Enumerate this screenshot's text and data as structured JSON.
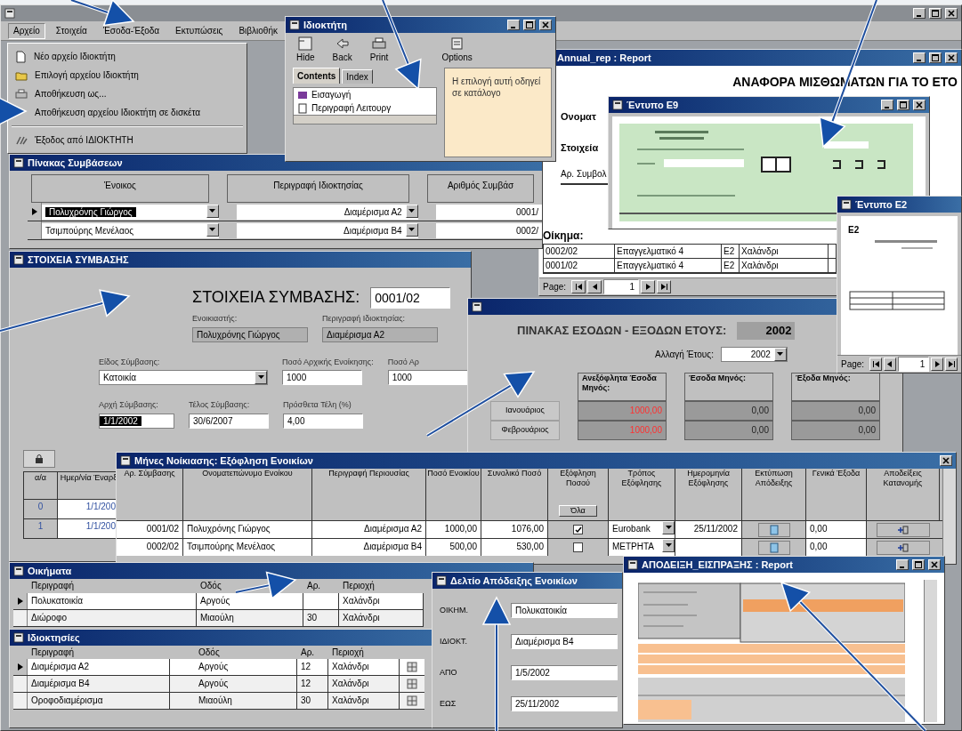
{
  "app": {
    "menu": [
      {
        "label": "Αρχείο",
        "selected": true
      },
      {
        "label": "Στοιχεία",
        "selected": false
      },
      {
        "label": "Έσοδα-Έξοδα",
        "selected": false
      },
      {
        "label": "Εκτυπώσεις",
        "selected": false
      },
      {
        "label": "Βιβλιοθήκ",
        "selected": false
      }
    ]
  },
  "file_menu": {
    "items": [
      {
        "label": "Νέο αρχείο Ιδιοκτήτη",
        "kind": "new"
      },
      {
        "label": "Επιλογή αρχείου Ιδιοκτήτη",
        "kind": "open"
      },
      {
        "label": "Αποθήκευση ως...",
        "kind": "save"
      },
      {
        "label": "Αποθήκευση αρχείου Ιδιοκτήτη σε δισκέτα",
        "kind": "plain"
      },
      {
        "kind": "separator"
      },
      {
        "label": "Έξοδος από ΙΔΙΟΚΤΗΤΗ",
        "kind": "exit"
      }
    ]
  },
  "help_window": {
    "title": "Ιδιοκτήτη",
    "toolbar": [
      "Hide",
      "Back",
      "Print",
      "Options"
    ],
    "tabs": [
      {
        "label": "Contents",
        "selected": true
      },
      {
        "label": "Index",
        "selected": false
      }
    ],
    "topics": [
      "Εισαγωγή",
      "Περιγραφή Λειτουργ"
    ],
    "topic_text": "Η επιλογή αυτή οδηγεί σε κατάλογο"
  },
  "annual_report": {
    "title": "Annual_rep : Report",
    "heading": "ΑΝΑΦΟΡΑ ΜΙΣΘΩΜΑΤΩΝ ΓΙΑ ΤΟ ΕΤΟ",
    "labels": [
      "Ονοματ",
      "Στοιχεία"
    ],
    "column": "Αρ. Συμβολ",
    "section": "Οίκημα:",
    "rows": [
      [
        "0002/02",
        "Επαγγελματικό 4",
        "Ε2",
        "Χαλάνδρι"
      ],
      [
        "0001/02",
        "Επαγγελματικό 4",
        "Ε2",
        "Χαλάνδρι"
      ]
    ],
    "page_label": "Page:",
    "page": "1"
  },
  "e9_window": {
    "title": "Έντυπο Ε9"
  },
  "contracts_window": {
    "title": "Πίνακας Συμβάσεων",
    "columns": [
      "Ένοικος",
      "Περιγραφή Ιδιοκτησίας",
      "Αριθμός Συμβάσ"
    ],
    "rows": [
      {
        "selected": true,
        "tenant": "Πολυχρόνης Γιώργος",
        "property": "Διαμέρισμα Α2",
        "contract": "0001/"
      },
      {
        "selected": false,
        "tenant": "Τσιμπούρης Μενέλαος",
        "property": "Διαμέρισμα Β4",
        "contract": "0002/"
      }
    ]
  },
  "contract_details": {
    "title": "ΣΤΟΙΧΕΙΑ ΣΥΜΒΑΣΗΣ",
    "heading": "ΣΤΟΙΧΕΙΑ ΣΥΜΒΑΣΗΣ:",
    "number": "0001/02",
    "field_rows": [
      [
        {
          "label": "Ενοικιαστής:",
          "value": "Πολυχρόνης Γιώργος",
          "kind": "readonly"
        },
        {
          "label": "Περιγραφή Ιδιοκτησίας:",
          "value": "Διαμέρισμα Α2",
          "kind": "readonly"
        }
      ],
      [
        {
          "label": "Είδος Σύμβασης:",
          "value": "Κατοικία",
          "kind": "dropdown"
        },
        {
          "label": "Ποσό Αρχικής Ενοίκησης:",
          "value": "1000",
          "kind": "text"
        },
        {
          "label": "Ποσό Αρ",
          "value": "1000",
          "kind": "text"
        }
      ],
      [
        {
          "label": "Αρχή Σύμβασης:",
          "value": "1/1/2002",
          "kind": "highlighted"
        },
        {
          "label": "Τέλος Σύμβασης:",
          "value": "30/6/2007",
          "kind": "text"
        },
        {
          "label": "Πρόσθετα Τέλη (%)",
          "value": "4,00",
          "kind": "text"
        }
      ]
    ],
    "history": {
      "columns": [
        "α/α",
        "Ημερ/νία Έναρξ"
      ],
      "rows": [
        [
          "0",
          "1/1/200"
        ],
        [
          "1",
          "1/1/200"
        ]
      ]
    }
  },
  "income_window": {
    "heading": "ΠΙΝΑΚΑΣ ΕΣΟΔΩΝ - ΕΞΟΔΩΝ ΕΤΟΥΣ:",
    "year": "2002",
    "change_label": "Αλλαγή Έτους:",
    "change_value": "2002",
    "columns": [
      "Ανεξόφλητα Έσοδα Μηνός:",
      "Έσοδα Μηνός:",
      "Έξοδα Μηνός:"
    ],
    "rows": [
      {
        "month": "Ιανουάριος",
        "values": [
          {
            "text": "1000,00",
            "alert": true
          },
          {
            "text": "0,00",
            "alert": false
          },
          {
            "text": "0,00",
            "alert": false
          }
        ]
      },
      {
        "month": "Φεβρουάριος",
        "values": [
          {
            "text": "1000,00",
            "alert": true
          },
          {
            "text": "0,00",
            "alert": false
          },
          {
            "text": "0,00",
            "alert": false
          }
        ]
      }
    ]
  },
  "e2_window": {
    "title": "Έντυπο Ε2",
    "code": "Ε2",
    "page_label": "Page:",
    "page": "1"
  },
  "rent_window": {
    "title": "Μήνες Νοίκιασης: Εξόφληση Ενοικίων",
    "columns": [
      "Αρ. Σύμβασης",
      "Ονοματεπώνυμο Ενοίκου",
      "Περιγραφή Περιουσίας",
      "Ποσό Ενοικίου",
      "Συνολικό Ποσό",
      "Εξόφληση Ποσού",
      "Τρόπος Εξόφλησης",
      "Ημερομηνία Εξόφλησης",
      "Εκτύπωση Απόδειξης",
      "Γενικά Έξοδα",
      "Αποδείξεις Κατανομής"
    ],
    "all_button": "Όλα",
    "rows": [
      {
        "contract": "0001/02",
        "tenant": "Πολυχρόνης Γιώργος",
        "property": "Διαμέρισμα Α2",
        "rent": "1000,00",
        "total": "1076,00",
        "paid": true,
        "method": "Eurobank",
        "date": "25/11/2002",
        "expenses": "0,00"
      },
      {
        "contract": "0002/02",
        "tenant": "Τσιμπούρης Μενέλαος",
        "property": "Διαμέρισμα Β4",
        "rent": "500,00",
        "total": "530,00",
        "paid": false,
        "method": "ΜΕΤΡΗΤΑ",
        "date": "",
        "expenses": "0,00"
      }
    ]
  },
  "buildings_window": {
    "title": "Οικήματα",
    "columns": [
      "Περιγραφή",
      "Οδός",
      "Αρ.",
      "Περιοχή"
    ],
    "rows": [
      {
        "selected": true,
        "cells": [
          "Πολυκατοικία",
          "Αργούς",
          "",
          "Χαλάνδρι"
        ]
      },
      {
        "selected": false,
        "cells": [
          "Διώροφο",
          "Μιαούλη",
          "30",
          "Χαλάνδρι"
        ]
      }
    ]
  },
  "properties_window": {
    "title": "Ιδιοκτησίες",
    "columns": [
      "Περιγραφή",
      "Οδός",
      "Αρ.",
      "Περιοχή"
    ],
    "rows": [
      {
        "selected": true,
        "cells": [
          "Διαμέρισμα Α2",
          "Αργούς",
          "12",
          "Χαλάνδρι"
        ]
      },
      {
        "selected": false,
        "cells": [
          "Διαμέρισμα Β4",
          "Αργούς",
          "12",
          "Χαλάνδρι"
        ]
      },
      {
        "selected": false,
        "cells": [
          "Οροφοδιαμέρισμα",
          "Μιαούλη",
          "30",
          "Χαλάνδρι"
        ]
      }
    ]
  },
  "receipt_form": {
    "title": "Δελτίο Απόδειξης Ενοικίων",
    "fields": [
      {
        "label": "ΟΙΚΗΜ.",
        "value": "Πολυκατοικία"
      },
      {
        "label": "ΙΔΙΟΚΤ.",
        "value": "Διαμέρισμα Β4"
      },
      {
        "label": "ΑΠΟ",
        "value": "1/5/2002"
      },
      {
        "label": "ΕΩΣ",
        "value": "25/11/2002"
      }
    ]
  },
  "receipt_report": {
    "title": "ΑΠΟΔΕΙΞΗ_ΕΙΣΠΡΑΞΗΣ : Report"
  }
}
